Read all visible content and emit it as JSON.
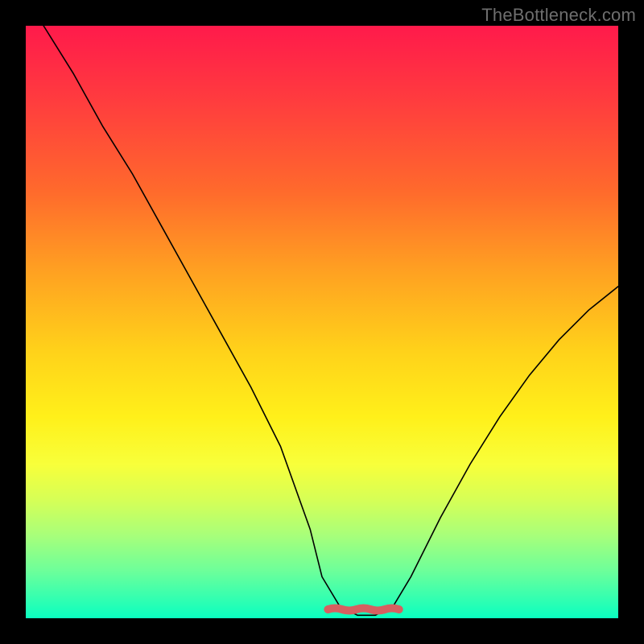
{
  "watermark": {
    "text": "TheBottleneck.com"
  },
  "chart_data": {
    "type": "line",
    "title": "",
    "xlabel": "",
    "ylabel": "",
    "xlim": [
      0,
      100
    ],
    "ylim": [
      0,
      100
    ],
    "grid": false,
    "legend": false,
    "series": [
      {
        "name": "curve",
        "color": "#000000",
        "x": [
          3,
          8,
          13,
          18,
          23,
          28,
          33,
          38,
          43,
          48,
          50,
          53,
          56,
          59,
          62,
          65,
          70,
          75,
          80,
          85,
          90,
          95,
          100
        ],
        "y": [
          100,
          92,
          83,
          75,
          66,
          57,
          48,
          39,
          29,
          15,
          7,
          2,
          0.5,
          0.5,
          2,
          7,
          17,
          26,
          34,
          41,
          47,
          52,
          56
        ]
      }
    ],
    "annotations": [
      {
        "name": "red-bumps",
        "color": "#d66060",
        "y": 1.5,
        "x_range": [
          51,
          63
        ]
      }
    ],
    "background_gradient": {
      "top": "#ff1a4b",
      "bottom": "#0affc0"
    }
  }
}
